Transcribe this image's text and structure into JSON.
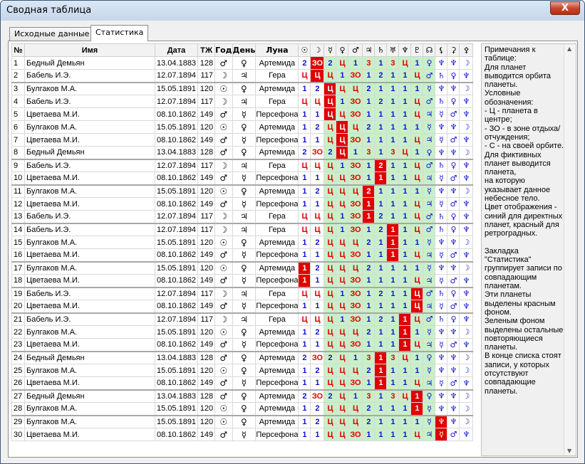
{
  "window": {
    "title": "Сводная таблица",
    "close_label": "X"
  },
  "tabs": [
    {
      "label": "Исходные данные",
      "active": false
    },
    {
      "label": "Статистика",
      "active": true
    }
  ],
  "columns": [
    "№",
    "Имя",
    "Дата",
    "ТЖ",
    "Год",
    "День",
    "Луна",
    "☉",
    "☽",
    "☿",
    "♀",
    "♂",
    "♃",
    "♄",
    "♅",
    "♆",
    "♇",
    "☊",
    "⚸",
    "⚳",
    "⚴"
  ],
  "rows": [
    [
      "1",
      "Бедный Демьян",
      "13.04.1883",
      "128",
      "♂",
      "♀",
      "Артемида",
      "2",
      "ЗО",
      "2",
      "Ц",
      "1",
      "3",
      "1",
      "3",
      "Ц",
      "1",
      "♀",
      "♆",
      "♆",
      "☽"
    ],
    [
      "2",
      "Бабель И.Э.",
      "12.07.1894",
      "117",
      "☽",
      "♃",
      "Гера",
      "Ц",
      "Ц",
      "Ц",
      "1",
      "ЗО",
      "1",
      "2",
      "1",
      "1",
      "Ц",
      "♂",
      "♄",
      "♀",
      "♆"
    ],
    [
      "3",
      "Булгаков М.А.",
      "15.05.1891",
      "120",
      "☉",
      "♀",
      "Артемида",
      "1",
      "2",
      "Ц",
      "Ц",
      "Ц",
      "2",
      "1",
      "1",
      "1",
      "1",
      "☿",
      "♆",
      "♆",
      "☽"
    ],
    [
      "4",
      "Бабель И.Э.",
      "12.07.1894",
      "117",
      "☽",
      "♃",
      "Гера",
      "Ц",
      "Ц",
      "Ц",
      "1",
      "ЗО",
      "1",
      "2",
      "1",
      "1",
      "Ц",
      "♂",
      "♄",
      "♀",
      "♆"
    ],
    [
      "5",
      "Цветаева М.И.",
      "08.10.1862",
      "149",
      "♂",
      "☿",
      "Персефона",
      "1",
      "1",
      "Ц",
      "Ц",
      "ЗО",
      "1",
      "1",
      "1",
      "1",
      "Ц",
      "♃",
      "☿",
      "♂",
      "♆"
    ],
    [
      "6",
      "Булгаков М.А.",
      "15.05.1891",
      "120",
      "☉",
      "♀",
      "Артемида",
      "1",
      "2",
      "Ц",
      "Ц",
      "Ц",
      "2",
      "1",
      "1",
      "1",
      "1",
      "☿",
      "♆",
      "♆",
      "☽"
    ],
    [
      "7",
      "Цветаева М.И.",
      "08.10.1862",
      "149",
      "♂",
      "☿",
      "Персефона",
      "1",
      "1",
      "Ц",
      "Ц",
      "ЗО",
      "1",
      "1",
      "1",
      "1",
      "Ц",
      "♃",
      "☿",
      "♂",
      "♆"
    ],
    [
      "8",
      "Бедный Демьян",
      "13.04.1883",
      "128",
      "♂",
      "♀",
      "Артемида",
      "2",
      "ЗО",
      "2",
      "Ц",
      "1",
      "3",
      "1",
      "3",
      "Ц",
      "1",
      "♀",
      "♆",
      "♆",
      "☽"
    ],
    [
      "9",
      "Бабель И.Э.",
      "12.07.1894",
      "117",
      "☽",
      "♃",
      "Гера",
      "Ц",
      "Ц",
      "Ц",
      "1",
      "ЗО",
      "1",
      "2",
      "1",
      "1",
      "Ц",
      "♂",
      "♄",
      "♀",
      "♆"
    ],
    [
      "10",
      "Цветаева М.И.",
      "08.10.1862",
      "149",
      "♂",
      "☿",
      "Персефона",
      "1",
      "1",
      "Ц",
      "Ц",
      "ЗО",
      "1",
      "1",
      "1",
      "1",
      "Ц",
      "♃",
      "☿",
      "♂",
      "♆"
    ],
    [
      "11",
      "Булгаков М.А.",
      "15.05.1891",
      "120",
      "☉",
      "♀",
      "Артемида",
      "1",
      "2",
      "Ц",
      "Ц",
      "Ц",
      "2",
      "1",
      "1",
      "1",
      "1",
      "☿",
      "♆",
      "♆",
      "☽"
    ],
    [
      "12",
      "Цветаева М.И.",
      "08.10.1862",
      "149",
      "♂",
      "☿",
      "Персефона",
      "1",
      "1",
      "Ц",
      "Ц",
      "ЗО",
      "1",
      "1",
      "1",
      "1",
      "Ц",
      "♃",
      "☿",
      "♂",
      "♆"
    ],
    [
      "13",
      "Бабель И.Э.",
      "12.07.1894",
      "117",
      "☽",
      "♃",
      "Гера",
      "Ц",
      "Ц",
      "Ц",
      "1",
      "ЗО",
      "1",
      "2",
      "1",
      "1",
      "Ц",
      "♂",
      "♄",
      "♀",
      "♆"
    ],
    [
      "14",
      "Бабель И.Э.",
      "12.07.1894",
      "117",
      "☽",
      "♃",
      "Гера",
      "Ц",
      "Ц",
      "Ц",
      "1",
      "ЗО",
      "1",
      "2",
      "1",
      "1",
      "Ц",
      "♂",
      "♄",
      "♀",
      "♆"
    ],
    [
      "15",
      "Булгаков М.А.",
      "15.05.1891",
      "120",
      "☉",
      "♀",
      "Артемида",
      "1",
      "2",
      "Ц",
      "Ц",
      "Ц",
      "2",
      "1",
      "1",
      "1",
      "1",
      "☿",
      "♆",
      "♆",
      "☽"
    ],
    [
      "16",
      "Цветаева М.И.",
      "08.10.1862",
      "149",
      "♂",
      "☿",
      "Персефона",
      "1",
      "1",
      "Ц",
      "Ц",
      "ЗО",
      "1",
      "1",
      "1",
      "1",
      "Ц",
      "♃",
      "☿",
      "♂",
      "♆"
    ],
    [
      "17",
      "Булгаков М.А.",
      "15.05.1891",
      "120",
      "☉",
      "♀",
      "Артемида",
      "1",
      "2",
      "Ц",
      "Ц",
      "Ц",
      "2",
      "1",
      "1",
      "1",
      "1",
      "☿",
      "♆",
      "♆",
      "☽"
    ],
    [
      "18",
      "Цветаева М.И.",
      "08.10.1862",
      "149",
      "♂",
      "☿",
      "Персефона",
      "1",
      "1",
      "Ц",
      "Ц",
      "ЗО",
      "1",
      "1",
      "1",
      "1",
      "Ц",
      "♃",
      "☿",
      "♂",
      "♆"
    ],
    [
      "19",
      "Бабель И.Э.",
      "12.07.1894",
      "117",
      "☽",
      "♃",
      "Гера",
      "Ц",
      "Ц",
      "Ц",
      "1",
      "ЗО",
      "1",
      "2",
      "1",
      "1",
      "Ц",
      "♂",
      "♄",
      "♀",
      "♆"
    ],
    [
      "20",
      "Цветаева М.И.",
      "08.10.1862",
      "149",
      "♂",
      "☿",
      "Персефона",
      "1",
      "1",
      "Ц",
      "Ц",
      "ЗО",
      "1",
      "1",
      "1",
      "1",
      "Ц",
      "♃",
      "☿",
      "♂",
      "♆"
    ],
    [
      "21",
      "Бабель И.Э.",
      "12.07.1894",
      "117",
      "☽",
      "♃",
      "Гера",
      "Ц",
      "Ц",
      "Ц",
      "1",
      "ЗО",
      "1",
      "2",
      "1",
      "1",
      "Ц",
      "♂",
      "♄",
      "♀",
      "♆"
    ],
    [
      "22",
      "Булгаков М.А.",
      "15.05.1891",
      "120",
      "☉",
      "♀",
      "Артемида",
      "1",
      "2",
      "Ц",
      "Ц",
      "Ц",
      "2",
      "1",
      "1",
      "1",
      "1",
      "☿",
      "♆",
      "♆",
      "☽"
    ],
    [
      "23",
      "Цветаева М.И.",
      "08.10.1862",
      "149",
      "♂",
      "☿",
      "Персефона",
      "1",
      "1",
      "Ц",
      "Ц",
      "ЗО",
      "1",
      "1",
      "1",
      "1",
      "Ц",
      "♃",
      "☿",
      "♂",
      "♆"
    ],
    [
      "24",
      "Бедный Демьян",
      "13.04.1883",
      "128",
      "♂",
      "♀",
      "Артемида",
      "2",
      "ЗО",
      "2",
      "Ц",
      "1",
      "3",
      "1",
      "3",
      "Ц",
      "1",
      "♀",
      "♆",
      "♆",
      "☽"
    ],
    [
      "25",
      "Булгаков М.А.",
      "15.05.1891",
      "120",
      "☉",
      "♀",
      "Артемида",
      "1",
      "2",
      "Ц",
      "Ц",
      "Ц",
      "2",
      "1",
      "1",
      "1",
      "1",
      "☿",
      "♆",
      "♆",
      "☽"
    ],
    [
      "26",
      "Цветаева М.И.",
      "08.10.1862",
      "149",
      "♂",
      "☿",
      "Персефона",
      "1",
      "1",
      "Ц",
      "Ц",
      "ЗО",
      "1",
      "1",
      "1",
      "1",
      "Ц",
      "♃",
      "☿",
      "♂",
      "♆"
    ],
    [
      "27",
      "Бедный Демьян",
      "13.04.1883",
      "128",
      "♂",
      "♀",
      "Артемида",
      "2",
      "ЗО",
      "2",
      "Ц",
      "1",
      "3",
      "1",
      "3",
      "Ц",
      "1",
      "♀",
      "♆",
      "♆",
      "☽"
    ],
    [
      "28",
      "Булгаков М.А.",
      "15.05.1891",
      "120",
      "☉",
      "♀",
      "Артемида",
      "1",
      "2",
      "Ц",
      "Ц",
      "Ц",
      "2",
      "1",
      "1",
      "1",
      "1",
      "☿",
      "♆",
      "♆",
      "☽"
    ],
    [
      "29",
      "Булгаков М.А.",
      "15.05.1891",
      "120",
      "☉",
      "♀",
      "Артемида",
      "1",
      "2",
      "Ц",
      "Ц",
      "Ц",
      "2",
      "1",
      "1",
      "1",
      "1",
      "☿",
      "♆",
      "♆",
      "☽"
    ],
    [
      "30",
      "Цветаева М.И.",
      "08.10.1862",
      "149",
      "♂",
      "☿",
      "Персефона",
      "1",
      "1",
      "Ц",
      "Ц",
      "ЗО",
      "1",
      "1",
      "1",
      "1",
      "Ц",
      "♃",
      "☿",
      "♂",
      "♆"
    ]
  ],
  "highlights": {
    "1": 1,
    "2": 1,
    "3": 2,
    "4": 2,
    "5": 2,
    "6": 3,
    "7": 3,
    "8": 3,
    "9": 6,
    "10": 6,
    "11": 5,
    "12": 5,
    "13": 5,
    "14": 7,
    "15": 7,
    "16": 7,
    "17": 0,
    "18": 0,
    "19": 9,
    "20": 9,
    "21": 8,
    "22": 8,
    "23": 8,
    "24": 6,
    "25": 6,
    "26": 6,
    "27": 9,
    "28": 9,
    "29": 11,
    "30": 11
  },
  "group_starts": [
    3,
    9,
    11,
    14,
    17,
    19,
    21,
    24,
    27,
    29
  ],
  "notes": "Примечания к таблице:\nДля планет выводится орбита планеты.\nУсловные обозначения:\n- Ц - планета в центре;\n- ЗО - в зоне отдыха/отчуждения;\n- С - на своей орбите.\nДля фиктивных планет выводится планета,\nна которую указывает данное небесное тело.\nЦвет отображения - синий для директных планет, красный для ретроградных.\n\nЗакладка \"Статистика\" группирует записи по совпадающим планетам.\nЭти планеты выделены красным фоном.\nЗеленым фоном выделены остальные повторяющиеся планеты.\nВ конце списка стоят записи, у которых отсутствуют совпадающие планеты.",
  "colors": {
    "direct": "#1010d0",
    "retro": "#e00000",
    "match_bg": "#e00000",
    "repeat_bg": "#c8f0c8"
  }
}
